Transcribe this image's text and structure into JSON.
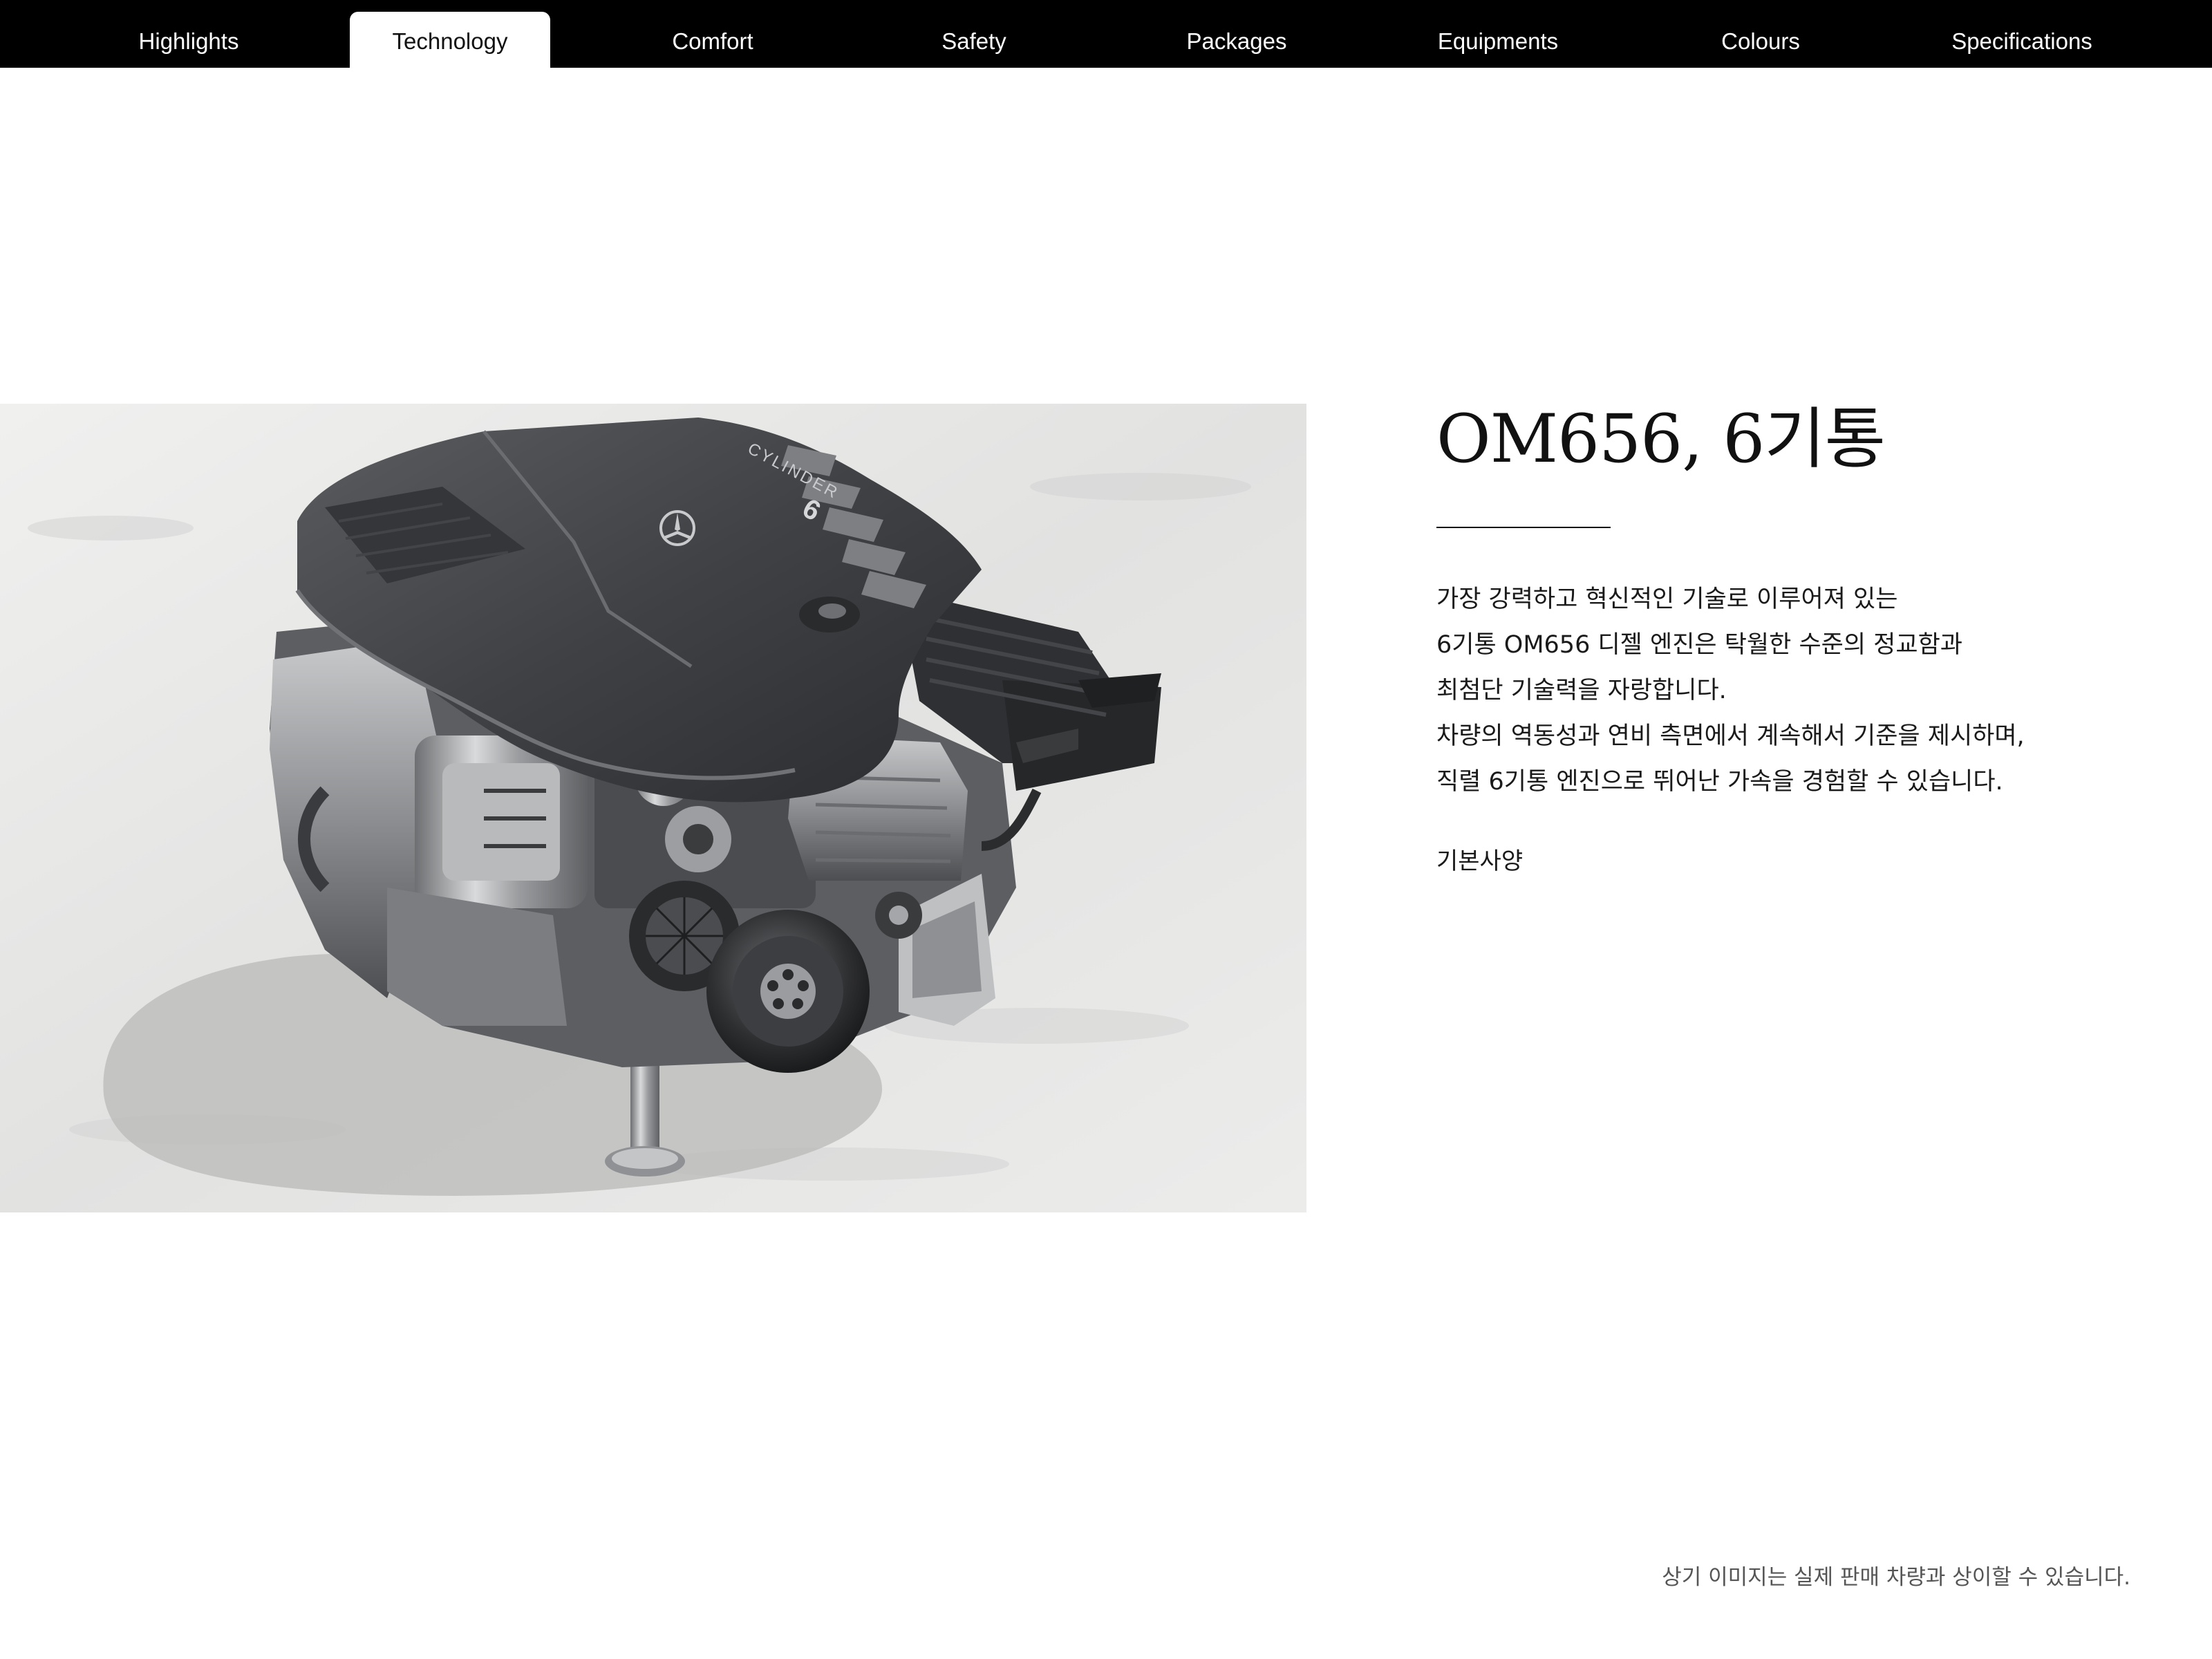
{
  "nav": {
    "tabs": [
      {
        "label": "Highlights",
        "active": false
      },
      {
        "label": "Technology",
        "active": true
      },
      {
        "label": "Comfort",
        "active": false
      },
      {
        "label": "Safety",
        "active": false
      },
      {
        "label": "Packages",
        "active": false
      },
      {
        "label": "Equipments",
        "active": false
      },
      {
        "label": "Colours",
        "active": false
      },
      {
        "label": "Specifications",
        "active": false
      }
    ]
  },
  "hero": {
    "image_name": "engine-image",
    "engine_cover_text": "CYLINDER",
    "engine_cover_number": "6"
  },
  "content": {
    "title": "OM656, 6기통",
    "description_lines": [
      "가장 강력하고 혁신적인 기술로 이루어져 있는",
      "6기통 OM656 디젤 엔진은 탁월한 수준의 정교함과",
      "최첨단 기술력을 자랑합니다.",
      "차량의 역동성과 연비 측면에서 계속해서 기준을 제시하며,",
      "직렬 6기통 엔진으로 뛰어난 가속을 경험할 수 있습니다."
    ],
    "availability": "기본사양"
  },
  "footer": {
    "disclaimer": "상기 이미지는 실제 판매 차량과 상이할 수 있습니다."
  },
  "colors": {
    "nav_background": "#000000",
    "nav_text": "#ffffff",
    "active_tab_background": "#ffffff",
    "page_background": "#ffffff",
    "text": "#111111"
  }
}
